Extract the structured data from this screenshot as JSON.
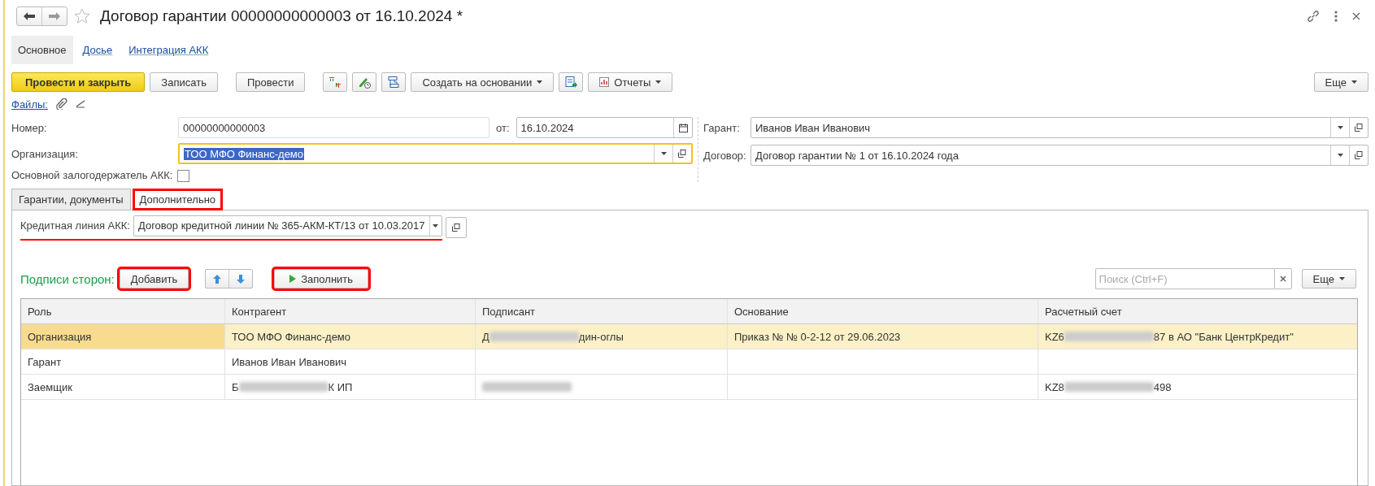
{
  "window": {
    "title": "Договор гарантии 00000000000003 от 16.10.2024 *"
  },
  "sections": [
    {
      "label": "Основное",
      "selected": true
    },
    {
      "label": "Досье",
      "selected": false
    },
    {
      "label": "Интеграция АКК",
      "selected": false
    }
  ],
  "toolbar": {
    "primary": "Провести и закрыть",
    "items": [
      {
        "kind": "button",
        "label": "Записать"
      },
      {
        "kind": "button",
        "label": "Провести"
      },
      {
        "kind": "icon"
      },
      {
        "kind": "icon"
      },
      {
        "kind": "icon"
      },
      {
        "kind": "menu",
        "label": "Создать на основании"
      },
      {
        "kind": "icon"
      },
      {
        "kind": "icon-menu",
        "label": "Отчеты"
      }
    ],
    "more": "Еще"
  },
  "files": {
    "label": "Файлы:"
  },
  "form": {
    "number": {
      "label": "Номер:",
      "value": "00000000000003"
    },
    "date": {
      "label": "от:",
      "value": "16.10.2024"
    },
    "organization": {
      "label": "Организация:",
      "value": "ТОО МФО Финанс-демо",
      "focused": true
    },
    "main_pledgee": {
      "label": "Основной залогодержатель АКК:",
      "checked": false
    },
    "guarantor": {
      "label": "Гарант:",
      "value": "Иванов Иван Иванович"
    },
    "contract": {
      "label": "Договор:",
      "value": "Договор гарантии № 1 от 16.10.2024 года"
    }
  },
  "tabs": [
    {
      "label": "Гарантии, документы",
      "selected": false,
      "highlighted": false
    },
    {
      "label": "Дополнительно",
      "selected": true,
      "highlighted": true
    }
  ],
  "credit_line": {
    "label": "Кредитная линия АКК:",
    "value": "Договор кредитной линии № 365-АКМ-КТ/13 от 10.03.2017",
    "underlined": true
  },
  "signatures": {
    "title": "Подписи сторон:",
    "add": {
      "label": "Добавить",
      "highlighted": true
    },
    "fill": {
      "label": "Заполнить",
      "highlighted": true
    },
    "search": {
      "placeholder": "Поиск (Ctrl+F)"
    },
    "more": "Еще",
    "columns": [
      "Роль",
      "Контрагент",
      "Подписант",
      "Основание",
      "Расчетный счет"
    ],
    "rows": [
      {
        "selected": true,
        "role": [
          {
            "kind": "text",
            "text": "Организация"
          }
        ],
        "counterparty": [
          {
            "kind": "text",
            "text": "ТОО МФО Финанс-демо"
          }
        ],
        "signer": [
          {
            "kind": "text",
            "text": "Д"
          },
          {
            "kind": "blurred"
          },
          {
            "kind": "text",
            "text": "дин-оглы"
          }
        ],
        "basis": [
          {
            "kind": "text",
            "text": "Приказ №  № 0-2-12 от 29.06.2023"
          }
        ],
        "account": [
          {
            "kind": "text",
            "text": "KZ6"
          },
          {
            "kind": "blurred"
          },
          {
            "kind": "text",
            "text": "87 в АО \"Банк ЦентрКредит\""
          }
        ]
      },
      {
        "selected": false,
        "role": [
          {
            "kind": "text",
            "text": "Гарант"
          }
        ],
        "counterparty": [
          {
            "kind": "text",
            "text": "Иванов Иван Иванович"
          }
        ]
      },
      {
        "selected": false,
        "role": [
          {
            "kind": "text",
            "text": "Заемщик"
          }
        ],
        "counterparty": [
          {
            "kind": "text",
            "text": "Б"
          },
          {
            "kind": "blurred"
          },
          {
            "kind": "text",
            "text": "К ИП"
          }
        ],
        "signer": [
          {
            "kind": "blurred"
          }
        ],
        "account": [
          {
            "kind": "text",
            "text": "KZ8"
          },
          {
            "kind": "blurred"
          },
          {
            "kind": "text",
            "text": "498"
          }
        ]
      }
    ]
  }
}
